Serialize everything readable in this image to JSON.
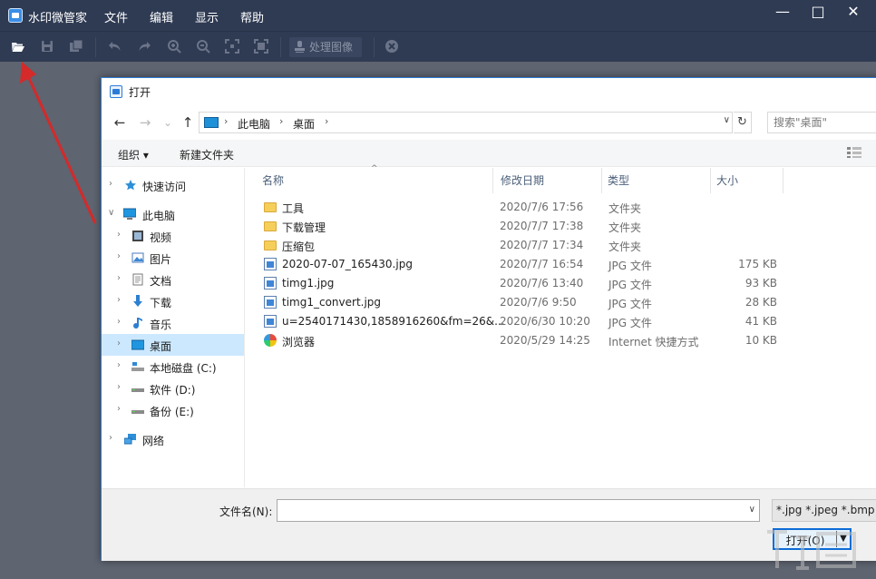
{
  "app": {
    "title": "水印微管家",
    "menu": [
      "文件",
      "编辑",
      "显示",
      "帮助"
    ],
    "window_controls": {
      "minimize": "—",
      "maximize": "□",
      "close": "✕"
    },
    "toolbar": {
      "process_label": "处理图像",
      "icons": [
        "open-folder-icon",
        "save-icon",
        "save-all-icon",
        "undo-icon",
        "redo-icon",
        "zoom-in-icon",
        "zoom-out-icon",
        "fit-icon",
        "actual-size-icon",
        "stamp-icon",
        "stop-icon"
      ]
    }
  },
  "dialog": {
    "title": "打开",
    "nav_buttons": {
      "back": "←",
      "forward": "→",
      "recent": "⌄",
      "up": "↑"
    },
    "address": {
      "crumbs": [
        "此电脑",
        "桌面"
      ],
      "separator": "›"
    },
    "refresh": "↻",
    "search_placeholder": "搜索\"桌面\"",
    "commands": {
      "organize": "组织 ▾",
      "new_folder": "新建文件夹"
    },
    "nav_pane": [
      {
        "label": "快速访问",
        "icon": "star-icon"
      },
      {
        "label": "此电脑",
        "icon": "computer-icon",
        "expanded": true
      },
      {
        "label": "视频",
        "icon": "video-icon"
      },
      {
        "label": "图片",
        "icon": "picture-icon"
      },
      {
        "label": "文档",
        "icon": "document-icon"
      },
      {
        "label": "下载",
        "icon": "download-icon"
      },
      {
        "label": "音乐",
        "icon": "music-icon"
      },
      {
        "label": "桌面",
        "icon": "desktop-icon",
        "selected": true
      },
      {
        "label": "本地磁盘 (C:)",
        "icon": "drive-c-icon"
      },
      {
        "label": "软件 (D:)",
        "icon": "drive-icon"
      },
      {
        "label": "备份 (E:)",
        "icon": "drive-icon"
      },
      {
        "label": "网络",
        "icon": "network-icon"
      }
    ],
    "columns": {
      "name": "名称",
      "date": "修改日期",
      "type": "类型",
      "size": "大小"
    },
    "files": [
      {
        "name": "工具",
        "date": "2020/7/6 17:56",
        "type": "文件夹",
        "size": "",
        "kind": "folder"
      },
      {
        "name": "下载管理",
        "date": "2020/7/7 17:38",
        "type": "文件夹",
        "size": "",
        "kind": "folder"
      },
      {
        "name": "压缩包",
        "date": "2020/7/7 17:34",
        "type": "文件夹",
        "size": "",
        "kind": "folder"
      },
      {
        "name": "2020-07-07_165430.jpg",
        "date": "2020/7/7 16:54",
        "type": "JPG 文件",
        "size": "175 KB",
        "kind": "jpg"
      },
      {
        "name": "timg1.jpg",
        "date": "2020/7/6 13:40",
        "type": "JPG 文件",
        "size": "93 KB",
        "kind": "jpg"
      },
      {
        "name": "timg1_convert.jpg",
        "date": "2020/7/6 9:50",
        "type": "JPG 文件",
        "size": "28 KB",
        "kind": "jpg"
      },
      {
        "name": "u=2540171430,1858916260&fm=26&...",
        "date": "2020/6/30 10:20",
        "type": "JPG 文件",
        "size": "41 KB",
        "kind": "jpg"
      },
      {
        "name": "浏览器",
        "date": "2020/5/29 14:25",
        "type": "Internet 快捷方式",
        "size": "10 KB",
        "kind": "web"
      }
    ],
    "filename_label": "文件名(N):",
    "filename_value": "",
    "filter_value": "*.jpg *.jpeg *.bmp *",
    "open_button": "打开(O)",
    "open_split": "▼"
  },
  "colors": {
    "app_bar": "#2f3b53",
    "app_background": "#5e6470",
    "dialog_border": "#2b7bd6",
    "selection": "#cce8ff",
    "arrow": "#d42a2a"
  }
}
